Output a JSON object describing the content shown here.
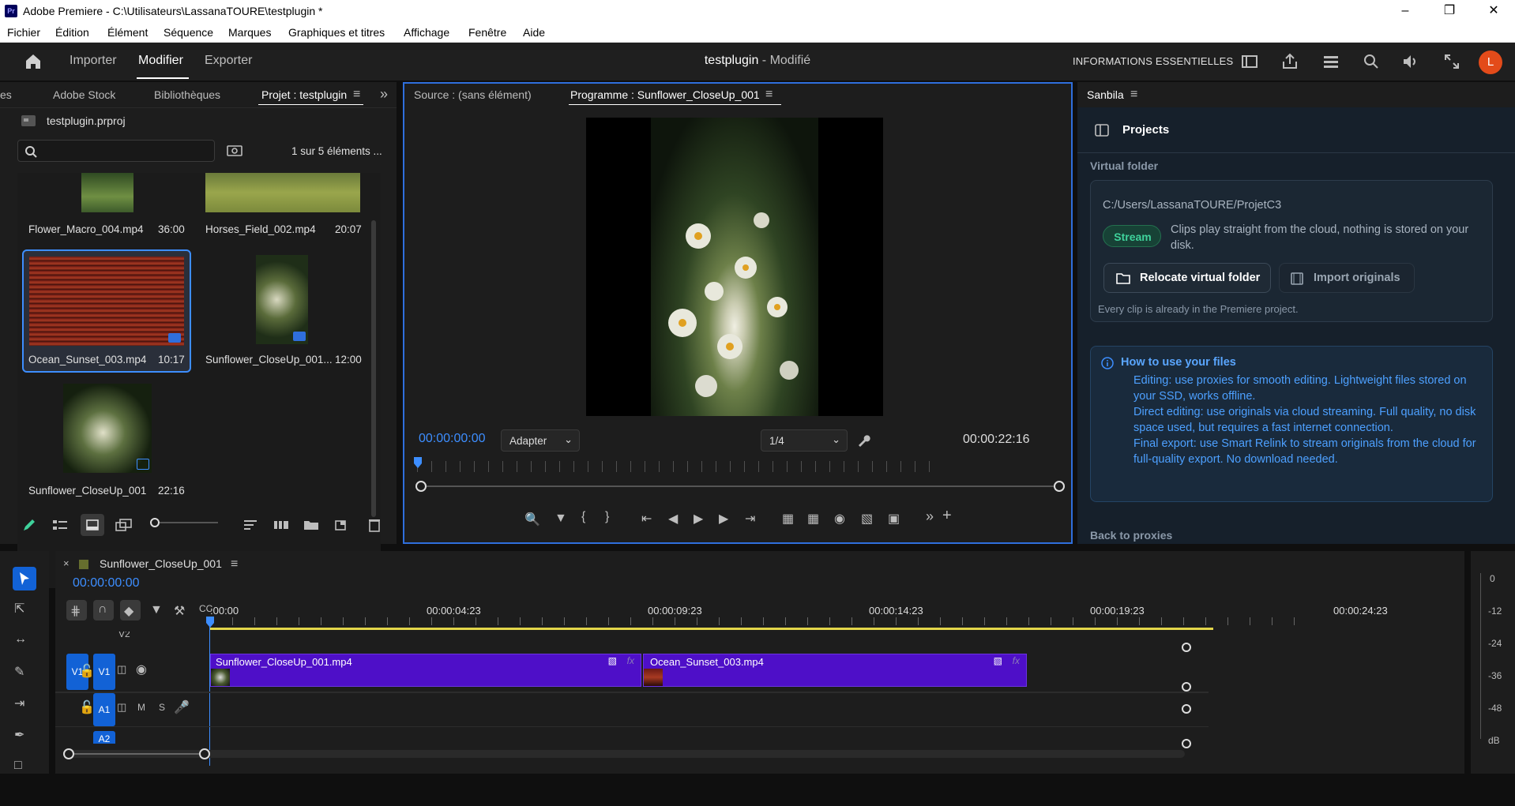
{
  "window": {
    "app_badge": "Pr",
    "title": "Adobe Premiere - C:\\Utilisateurs\\LassanaTOURE\\testplugin *"
  },
  "menu": [
    "Fichier",
    "Édition",
    "Élément",
    "Séquence",
    "Marques",
    "Graphiques et titres",
    "Affichage",
    "Fenêtre",
    "Aide"
  ],
  "header": {
    "nav": [
      "Importer",
      "Modifier",
      "Exporter"
    ],
    "active_nav": "Modifier",
    "project_name": "testplugin",
    "project_status": " - Modifié",
    "workspace": "INFORMATIONS ESSENTIELLES",
    "avatar_initial": "L"
  },
  "project_panel": {
    "tabs": [
      "es",
      "Adobe Stock",
      "Bibliothèques",
      "Projet : testplugin"
    ],
    "file": "testplugin.prproj",
    "count": "1 sur 5 éléments ...",
    "items": [
      {
        "name": "Flower_Macro_004.mp4",
        "duration": "36:00"
      },
      {
        "name": "Horses_Field_002.mp4",
        "duration": "20:07"
      },
      {
        "name": "Ocean_Sunset_003.mp4",
        "duration": "10:17"
      },
      {
        "name": "Sunflower_CloseUp_001...",
        "duration": "12:00"
      },
      {
        "name": "Sunflower_CloseUp_001",
        "duration": "22:16"
      }
    ]
  },
  "program_monitor": {
    "source_tab": "Source : (sans élément)",
    "program_tab": "Programme : Sunflower_CloseUp_001",
    "timecode": "00:00:00:00",
    "fit": "Adapter",
    "resolution": "1/4",
    "duration": "00:00:22:16"
  },
  "sanbila": {
    "tab": "Sanbila",
    "title": "Projects",
    "section": "Virtual folder",
    "path": "C:/Users/LassanaTOURE/ProjetC3",
    "badge": "Stream",
    "stream_desc": "Clips play straight from the cloud, nothing is stored on your disk.",
    "relocate": "Relocate virtual folder",
    "import": "Import originals",
    "note": "Every clip is already in the Premiere project.",
    "howto_title": "How to use your files",
    "howto": [
      "Editing: use proxies for smooth editing. Lightweight files stored on your SSD, works offline.",
      "Direct editing: use originals via cloud streaming. Full quality, no disk space used, but requires a fast internet connection.",
      "Final export: use Smart Relink to stream originals from the cloud for full-quality export. No download needed."
    ],
    "back": "Back to proxies"
  },
  "timeline": {
    "sequence": "Sunflower_CloseUp_001",
    "timecode": "00:00:00:00",
    "ruler": [
      ":00:00",
      "00:00:04:23",
      "00:00:09:23",
      "00:00:14:23",
      "00:00:19:23",
      "00:00:24:23"
    ],
    "tracks": {
      "v2": "V2",
      "v1_src": "V1",
      "v1": "V1",
      "a1": "A1",
      "a2": "A2",
      "m": "M",
      "s": "S"
    },
    "clips": [
      "Sunflower_CloseUp_001.mp4",
      "Ocean_Sunset_003.mp4"
    ],
    "fx": "fx"
  },
  "meters": {
    "labels": [
      "0",
      "-12",
      "-24",
      "-36",
      "-48",
      "dB"
    ]
  },
  "colors": {
    "accent": "#2f6fdd",
    "timecode": "#3d8eff",
    "clip": "#4e0fc8",
    "stream_badge": "#3fd29b"
  }
}
